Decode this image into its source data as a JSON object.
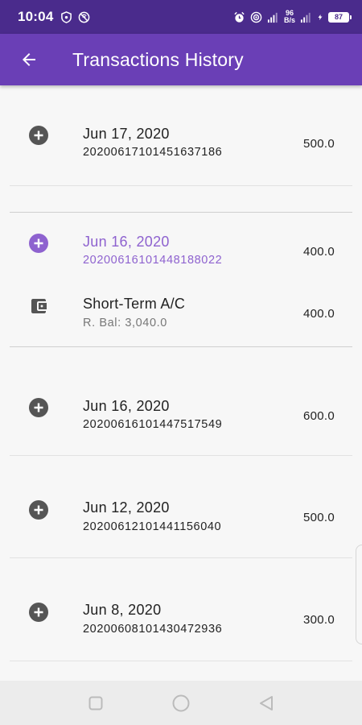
{
  "status_bar": {
    "time": "10:04",
    "net_speed_value": "96",
    "net_speed_unit": "B/s",
    "battery": "87"
  },
  "app_bar": {
    "title": "Transactions History"
  },
  "transactions": [
    {
      "date": "Jun 17, 2020",
      "ref": "20200617101451637186",
      "amount": "500.0",
      "icon": "plus-circle-icon"
    },
    {
      "date": "Jun 16, 2020",
      "ref": "20200616101448188022",
      "amount": "400.0",
      "icon": "plus-circle-icon",
      "selected": true
    },
    {
      "date": "Jun 16, 2020",
      "ref": "20200616101447517549",
      "amount": "600.0",
      "icon": "plus-circle-icon"
    },
    {
      "date": "Jun 12, 2020",
      "ref": "20200612101441156040",
      "amount": "500.0",
      "icon": "plus-circle-icon"
    },
    {
      "date": "Jun 8, 2020",
      "ref": "20200608101430472936",
      "amount": "300.0",
      "icon": "plus-circle-icon"
    }
  ],
  "detail": {
    "account": "Short-Term A/C",
    "balance": "R. Bal: 3,040.0",
    "amount": "400.0",
    "icon": "wallet-icon"
  },
  "colors": {
    "status_bar": "#4a2b8c",
    "app_bar": "#6a3fb6",
    "accent": "#8e62cf",
    "icon_gray": "#555555"
  }
}
